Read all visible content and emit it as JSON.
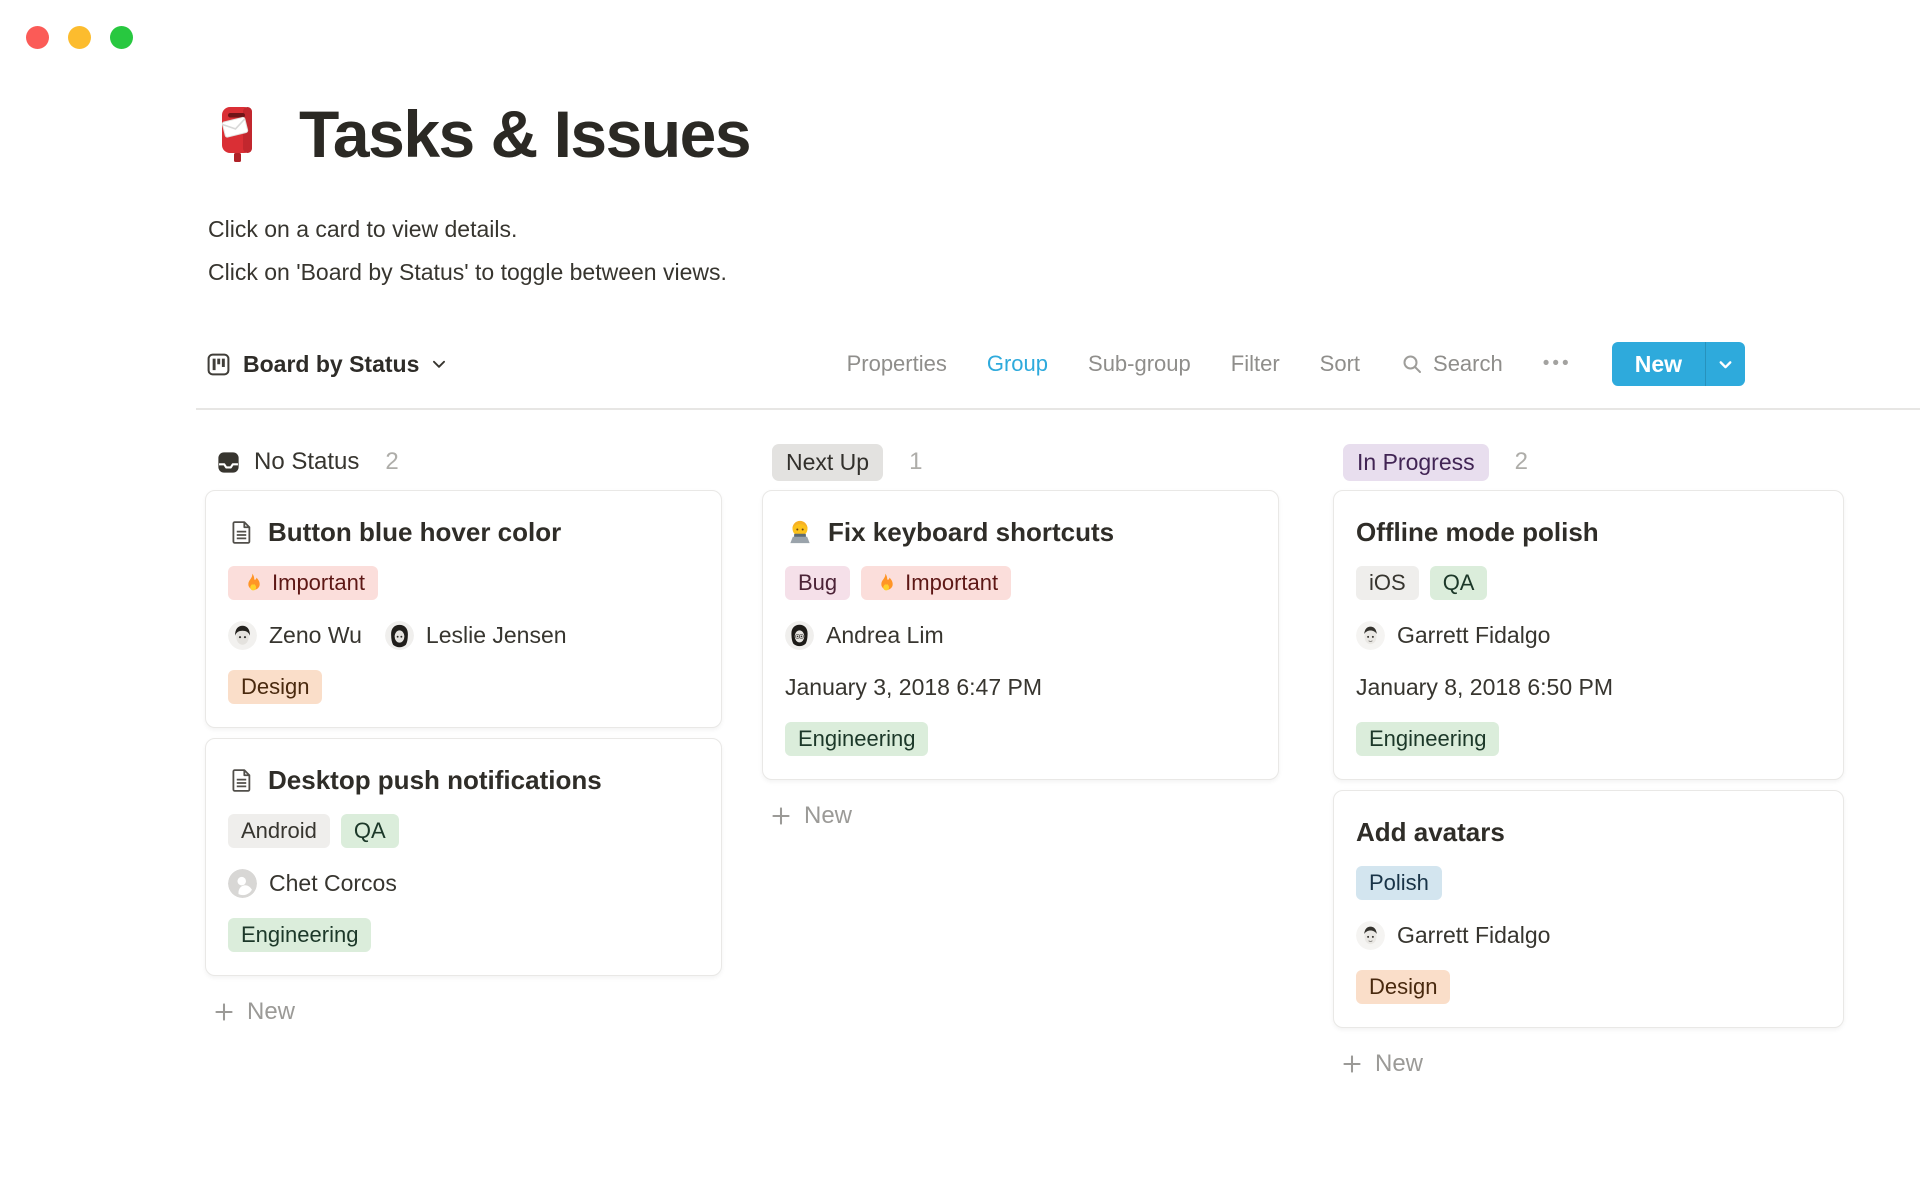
{
  "window": {
    "controls": [
      {
        "name": "close",
        "color": "#FB5B57"
      },
      {
        "name": "minimize",
        "color": "#FCBC2E"
      },
      {
        "name": "zoom",
        "color": "#28C840"
      }
    ]
  },
  "header": {
    "icon": "postbox-emoji",
    "title": "Tasks & Issues",
    "subtitle_line1": "Click on a card to view details.",
    "subtitle_line2": "Click on 'Board by Status' to toggle between views."
  },
  "toolbar": {
    "view_label": "Board by Status",
    "menu_items": [
      {
        "label": "Properties",
        "active": false
      },
      {
        "label": "Group",
        "active": true
      },
      {
        "label": "Sub-group",
        "active": false
      },
      {
        "label": "Filter",
        "active": false
      },
      {
        "label": "Sort",
        "active": false
      }
    ],
    "search_label": "Search",
    "more_label": "•••",
    "new_button_label": "New"
  },
  "board": {
    "columns": [
      {
        "header": {
          "label": "No Status",
          "count": "2",
          "style": "plain-with-inbox-icon"
        },
        "new_label": "New",
        "cards": [
          {
            "icon": "page-icon",
            "title": "Button blue hover color",
            "tags_top": [
              {
                "label": "Important",
                "color": "red",
                "fire_emoji": true
              }
            ],
            "people": [
              {
                "name": "Zeno Wu",
                "avatar": "photo-man-short-hair"
              },
              {
                "name": "Leslie Jensen",
                "avatar": "photo-woman-long-hair"
              }
            ],
            "tags_bottom": [
              {
                "label": "Design",
                "color": "orange"
              }
            ]
          },
          {
            "icon": "page-icon",
            "title": "Desktop push notifications",
            "tags_top": [
              {
                "label": "Android",
                "color": "gray"
              },
              {
                "label": "QA",
                "color": "green"
              }
            ],
            "people": [
              {
                "name": "Chet Corcos",
                "avatar": "default-silhouette"
              }
            ],
            "tags_bottom": [
              {
                "label": "Engineering",
                "color": "green"
              }
            ]
          }
        ]
      },
      {
        "header": {
          "label": "Next Up",
          "count": "1",
          "style": "pill",
          "pill_color": "gray"
        },
        "new_label": "New",
        "cards": [
          {
            "icon": "technologist-emoji",
            "title": "Fix keyboard shortcuts",
            "tags_top": [
              {
                "label": "Bug",
                "color": "pink"
              },
              {
                "label": "Important",
                "color": "red",
                "fire_emoji": true
              }
            ],
            "people": [
              {
                "name": "Andrea Lim",
                "avatar": "photo-woman-bob-glasses"
              }
            ],
            "date": "January 3, 2018 6:47 PM",
            "tags_bottom": [
              {
                "label": "Engineering",
                "color": "green"
              }
            ]
          }
        ]
      },
      {
        "header": {
          "label": "In Progress",
          "count": "2",
          "style": "pill",
          "pill_color": "purple"
        },
        "new_label": "New",
        "cards": [
          {
            "title": "Offline mode polish",
            "tags_top": [
              {
                "label": "iOS",
                "color": "gray"
              },
              {
                "label": "QA",
                "color": "green"
              }
            ],
            "people": [
              {
                "name": "Garrett Fidalgo",
                "avatar": "photo-man-short-hair-2"
              }
            ],
            "date": "January 8, 2018 6:50 PM",
            "tags_bottom": [
              {
                "label": "Engineering",
                "color": "green"
              }
            ]
          },
          {
            "title": "Add avatars",
            "tags_top": [
              {
                "label": "Polish",
                "color": "blue"
              }
            ],
            "people": [
              {
                "name": "Garrett Fidalgo",
                "avatar": "photo-man-short-hair-2"
              }
            ],
            "tags_bottom": [
              {
                "label": "Design",
                "color": "orange"
              }
            ]
          }
        ]
      }
    ]
  },
  "palette": {
    "accent_blue": "#2EAADC",
    "text_dark": "#37352F",
    "toolbar_gray": "#8F8E8B",
    "count_gray": "#AEADA9",
    "divider": "#E7E6E4",
    "card_border": "#E9E8E6",
    "tag_red_bg": "#FBDEDB",
    "tag_red_text": "#5D1715",
    "tag_orange_bg": "#FADEC9",
    "tag_orange_text": "#49290E",
    "tag_gray_bg": "#EFEEEC",
    "tag_gray_text": "#37352F",
    "tag_green_bg": "#DBEDDB",
    "tag_green_text": "#1C3829",
    "tag_pink_bg": "#F5E0E9",
    "tag_pink_text": "#4C2337",
    "tag_blue_bg": "#D3E5EF",
    "tag_blue_text": "#183347",
    "header_gray_pill_bg": "#E3E2E0",
    "header_purple_pill_bg": "#E8DEEE",
    "header_purple_pill_text": "#412454"
  }
}
